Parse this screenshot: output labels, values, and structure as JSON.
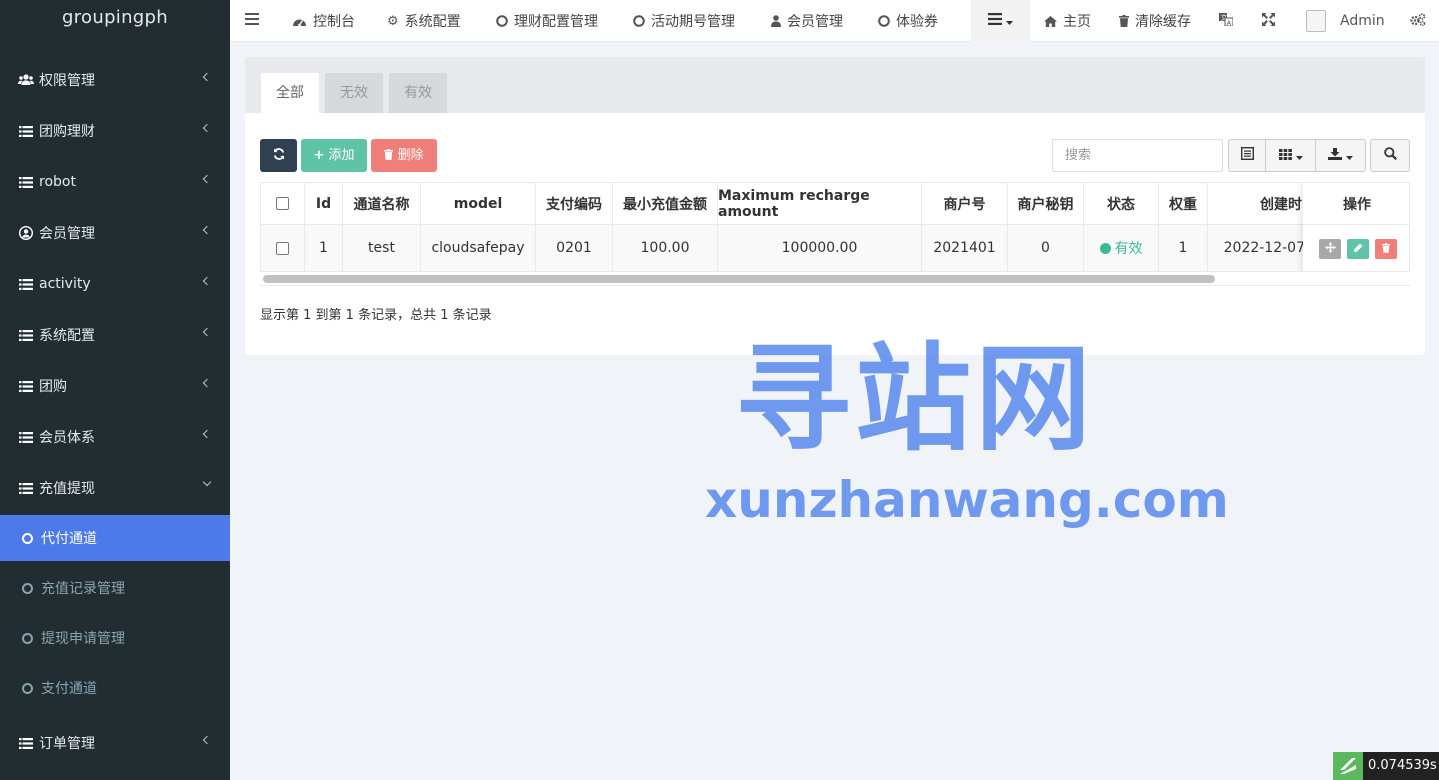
{
  "app": {
    "title": "groupingph"
  },
  "sidebar": {
    "items": [
      {
        "label": "权限管理",
        "icon": "users-icon"
      },
      {
        "label": "团购理财",
        "icon": "list-icon"
      },
      {
        "label": "robot",
        "icon": "list-icon"
      },
      {
        "label": "会员管理",
        "icon": "user-circle-icon"
      },
      {
        "label": "activity",
        "icon": "list-icon"
      },
      {
        "label": "系统配置",
        "icon": "list-icon"
      },
      {
        "label": "团购",
        "icon": "list-icon"
      },
      {
        "label": "会员体系",
        "icon": "list-icon"
      },
      {
        "label": "充值提现",
        "icon": "list-icon",
        "expanded": true
      },
      {
        "label": "订单管理",
        "icon": "list-icon"
      }
    ],
    "subitems": [
      {
        "label": "代付通道",
        "active": true
      },
      {
        "label": "充值记录管理"
      },
      {
        "label": "提现申请管理"
      },
      {
        "label": "支付通道"
      }
    ]
  },
  "topnav": {
    "items": [
      {
        "label": "控制台",
        "icon": "dashboard-icon"
      },
      {
        "label": "系统配置",
        "icon": "gear-icon"
      },
      {
        "label": "理财配置管理",
        "icon": "circle-icon"
      },
      {
        "label": "活动期号管理",
        "icon": "circle-icon"
      },
      {
        "label": "会员管理",
        "icon": "user-icon"
      },
      {
        "label": "体验券",
        "icon": "circle-icon"
      }
    ],
    "home": "主页",
    "clear_cache": "清除缓存",
    "user": "Admin"
  },
  "tabs": [
    "全部",
    "无效",
    "有效"
  ],
  "toolbar": {
    "add": "添加",
    "delete": "删除",
    "search_placeholder": "搜索"
  },
  "table": {
    "columns": [
      "Id",
      "通道名称",
      "model",
      "支付编码",
      "最小充值金额",
      "Maximum recharge amount",
      "商户号",
      "商户秘钥",
      "状态",
      "权重",
      "创建时",
      "操作"
    ],
    "rows": [
      {
        "id": "1",
        "name": "test",
        "model": "cloudsafepay",
        "code": "0201",
        "min": "100.00",
        "max": "100000.00",
        "merchant": "2021401",
        "secret": "0",
        "status": "有效",
        "weight": "1",
        "created": "2022-12-07"
      }
    ]
  },
  "summary": "显示第 1 到第 1 条记录，总共 1 条记录",
  "watermark": {
    "line1": "寻站网",
    "line2": "xunzhanwang.com"
  },
  "timer": "0.074539s",
  "colors": {
    "sidebar_bg": "#222d32",
    "active_blue": "#4d79e9",
    "refresh": "#2f4050",
    "add": "#5fc3a7",
    "delete": "#f07e7b",
    "status_green": "#3cbb8c",
    "move": "#a8a8a8"
  }
}
